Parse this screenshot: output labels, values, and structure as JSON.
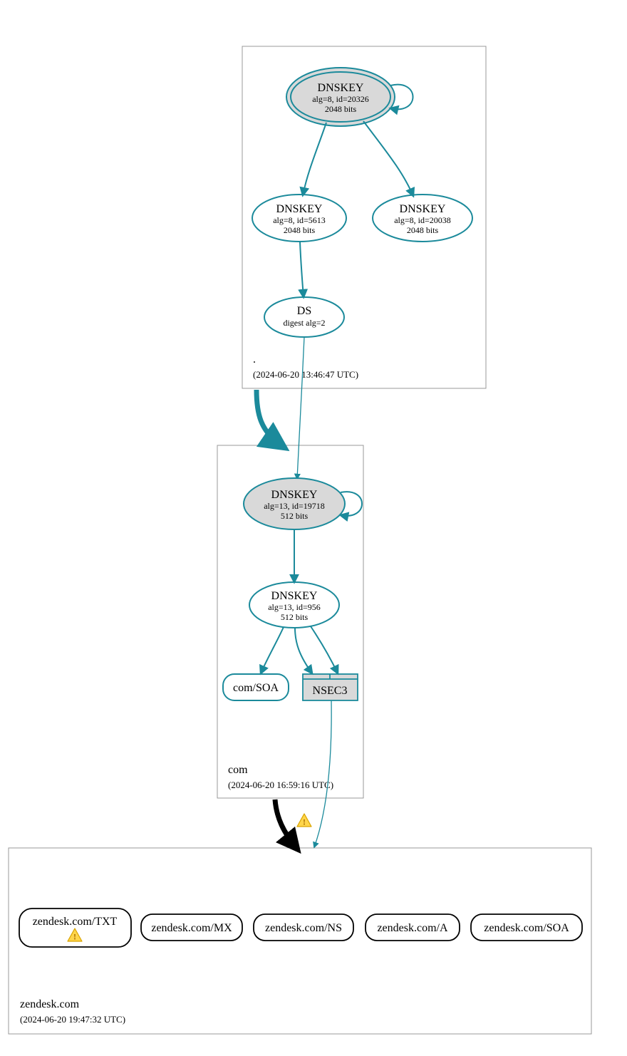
{
  "colors": {
    "teal": "#1b8a9b",
    "gray_fill": "#d9d9d9",
    "black": "#000000",
    "white": "#ffffff",
    "warn_fill": "#ffd54a",
    "warn_border": "#d9a400"
  },
  "zones": {
    "root": {
      "label": ".",
      "timestamp": "(2024-06-20 13:46:47 UTC)"
    },
    "com": {
      "label": "com",
      "timestamp": "(2024-06-20 16:59:16 UTC)"
    },
    "zendesk": {
      "label": "zendesk.com",
      "timestamp": "(2024-06-20 19:47:32 UTC)"
    }
  },
  "nodes": {
    "root_ksk": {
      "title": "DNSKEY",
      "line2": "alg=8, id=20326",
      "line3": "2048 bits"
    },
    "root_zsk1": {
      "title": "DNSKEY",
      "line2": "alg=8, id=5613",
      "line3": "2048 bits"
    },
    "root_zsk2": {
      "title": "DNSKEY",
      "line2": "alg=8, id=20038",
      "line3": "2048 bits"
    },
    "root_ds": {
      "title": "DS",
      "line2": "digest alg=2"
    },
    "com_ksk": {
      "title": "DNSKEY",
      "line2": "alg=13, id=19718",
      "line3": "512 bits"
    },
    "com_zsk": {
      "title": "DNSKEY",
      "line2": "alg=13, id=956",
      "line3": "512 bits"
    },
    "com_soa": {
      "label": "com/SOA"
    },
    "com_nsec3": {
      "label": "NSEC3"
    },
    "z_txt": {
      "label": "zendesk.com/TXT"
    },
    "z_mx": {
      "label": "zendesk.com/MX"
    },
    "z_ns": {
      "label": "zendesk.com/NS"
    },
    "z_a": {
      "label": "zendesk.com/A"
    },
    "z_soa": {
      "label": "zendesk.com/SOA"
    }
  }
}
